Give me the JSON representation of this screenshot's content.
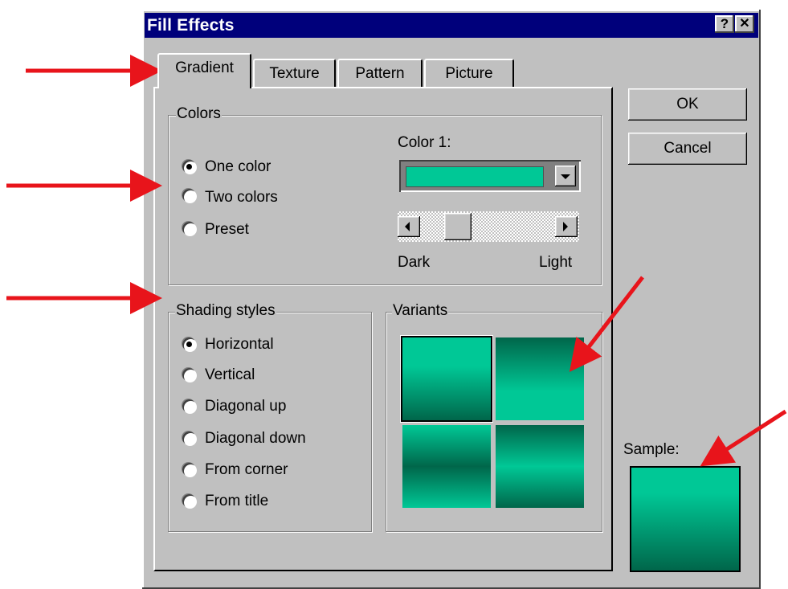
{
  "dialog": {
    "title": "Fill Effects",
    "help_label": "?",
    "close_label": "✕"
  },
  "tabs": [
    {
      "label": "Gradient",
      "active": true
    },
    {
      "label": "Texture",
      "active": false
    },
    {
      "label": "Pattern",
      "active": false
    },
    {
      "label": "Picture",
      "active": false
    }
  ],
  "buttons": {
    "ok": "OK",
    "cancel": "Cancel"
  },
  "colors_group": {
    "legend": "Colors",
    "options": [
      {
        "label": "One color",
        "selected": true
      },
      {
        "label": "Two colors",
        "selected": false
      },
      {
        "label": "Preset",
        "selected": false
      }
    ],
    "color1_label": "Color 1:",
    "color1_value": "#00c896",
    "slider_dark": "Dark",
    "slider_light": "Light"
  },
  "shading_group": {
    "legend": "Shading styles",
    "options": [
      {
        "label": "Horizontal",
        "selected": true
      },
      {
        "label": "Vertical",
        "selected": false
      },
      {
        "label": "Diagonal up",
        "selected": false
      },
      {
        "label": "Diagonal down",
        "selected": false
      },
      {
        "label": "From corner",
        "selected": false
      },
      {
        "label": "From title",
        "selected": false
      }
    ]
  },
  "variants_group": {
    "legend": "Variants"
  },
  "sample_label": "Sample:",
  "colors": {
    "light": "#00c896",
    "dark": "#00664a",
    "annotation_arrow": "#e8141b"
  }
}
